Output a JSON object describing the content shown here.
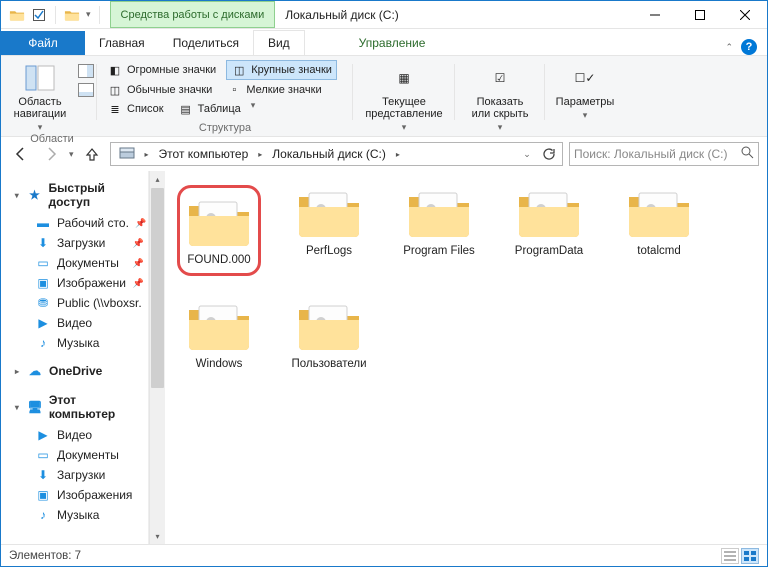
{
  "title": "Локальный диск (C:)",
  "disk_tools_label": "Средства работы с дисками",
  "tabs": {
    "file": "Файл",
    "home": "Главная",
    "share": "Поделиться",
    "view": "Вид",
    "manage": "Управление"
  },
  "ribbon": {
    "nav_pane": "Область\nнавигации",
    "nav_group": "Области",
    "icons_huge": "Огромные значки",
    "icons_large": "Крупные значки",
    "icons_normal": "Обычные значки",
    "icons_small": "Мелкие значки",
    "icons_list": "Список",
    "icons_table": "Таблица",
    "layout_group": "Структура",
    "current_view": "Текущее\nпредставление",
    "show_hide": "Показать\nили скрыть",
    "options": "Параметры"
  },
  "breadcrumb": {
    "this_pc": "Этот компьютер",
    "drive": "Локальный диск (C:)"
  },
  "search_placeholder": "Поиск: Локальный диск (C:)",
  "sidebar": {
    "quick_access": "Быстрый доступ",
    "desktop": "Рабочий сто.",
    "downloads": "Загрузки",
    "documents": "Документы",
    "pictures": "Изображени",
    "public": "Public (\\\\vboxsr.",
    "videos": "Видео",
    "music": "Музыка",
    "onedrive": "OneDrive",
    "this_pc": "Этот компьютер",
    "t_videos": "Видео",
    "t_documents": "Документы",
    "t_downloads": "Загрузки",
    "t_pictures": "Изображения",
    "t_music": "Музыка"
  },
  "folders": [
    {
      "name": "FOUND.000",
      "highlight": true
    },
    {
      "name": "PerfLogs"
    },
    {
      "name": "Program Files"
    },
    {
      "name": "ProgramData"
    },
    {
      "name": "totalcmd"
    },
    {
      "name": "Windows"
    },
    {
      "name": "Пользователи"
    }
  ],
  "status": {
    "count_label": "Элементов: 7"
  }
}
